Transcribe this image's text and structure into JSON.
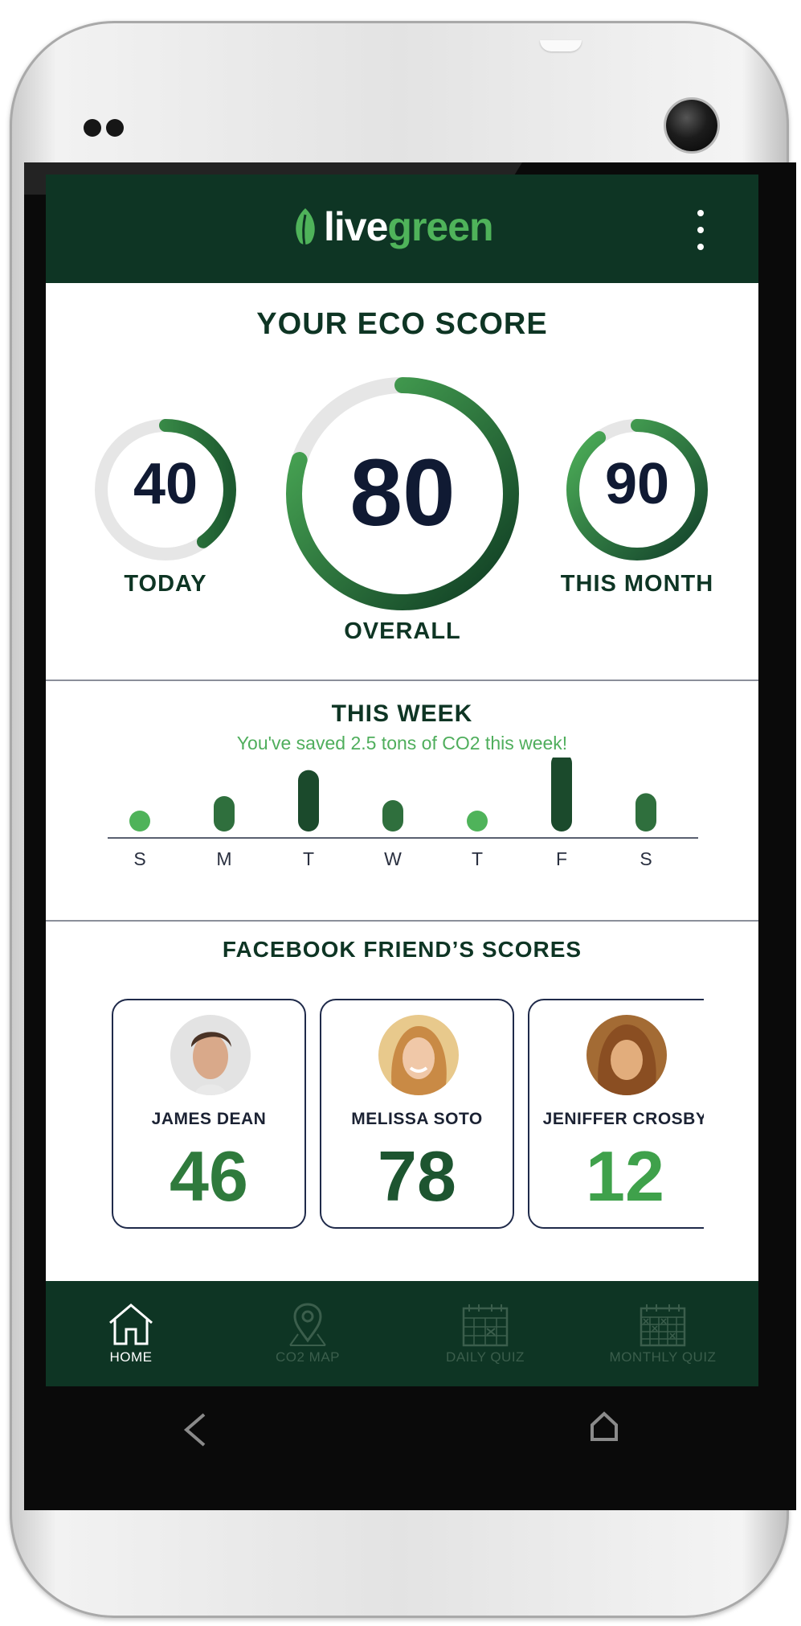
{
  "header": {
    "logo_live": "live",
    "logo_green": "green",
    "menu_icon": "kebab-menu-icon"
  },
  "eco_score": {
    "title": "YOUR ECO SCORE",
    "today": {
      "value": "40",
      "label": "TODAY",
      "fraction": 0.4
    },
    "overall": {
      "value": "80",
      "label": "OVERALL",
      "fraction": 0.8
    },
    "month": {
      "value": "90",
      "label": "THIS MONTH",
      "fraction": 0.9
    }
  },
  "week": {
    "title": "THIS WEEK",
    "subtitle": "You've saved 2.5 tons of CO2 this week!"
  },
  "chart_data": {
    "type": "bar",
    "categories": [
      "S",
      "M",
      "T",
      "W",
      "T",
      "F",
      "S"
    ],
    "values": [
      0,
      0.25,
      0.7,
      0.18,
      0,
      1.0,
      0.3
    ],
    "title": "THIS WEEK",
    "xlabel": "",
    "ylabel": "",
    "grid": false
  },
  "friends": {
    "title": "FACEBOOK FRIEND’S SCORES",
    "cards": [
      {
        "name": "JAMES DEAN",
        "score": "46",
        "color": "#2f7a3c"
      },
      {
        "name": "MELISSA SOTO",
        "score": "78",
        "color": "#1d5530"
      },
      {
        "name": "JENIFFER CROSBY",
        "score": "12",
        "color": "#3fa14b"
      }
    ]
  },
  "nav": {
    "items": [
      {
        "label": "HOME",
        "icon": "home-icon",
        "active": true
      },
      {
        "label": "CO2 MAP",
        "icon": "map-pin-icon",
        "active": false
      },
      {
        "label": "DAILY QUIZ",
        "icon": "calendar-icon",
        "active": false
      },
      {
        "label": "MONTHLY QUIZ",
        "icon": "calendar-grid-icon",
        "active": false
      }
    ]
  },
  "colors": {
    "brand_dark": "#0e3524",
    "brand_green": "#4fb35a",
    "text_navy": "#101a33"
  }
}
